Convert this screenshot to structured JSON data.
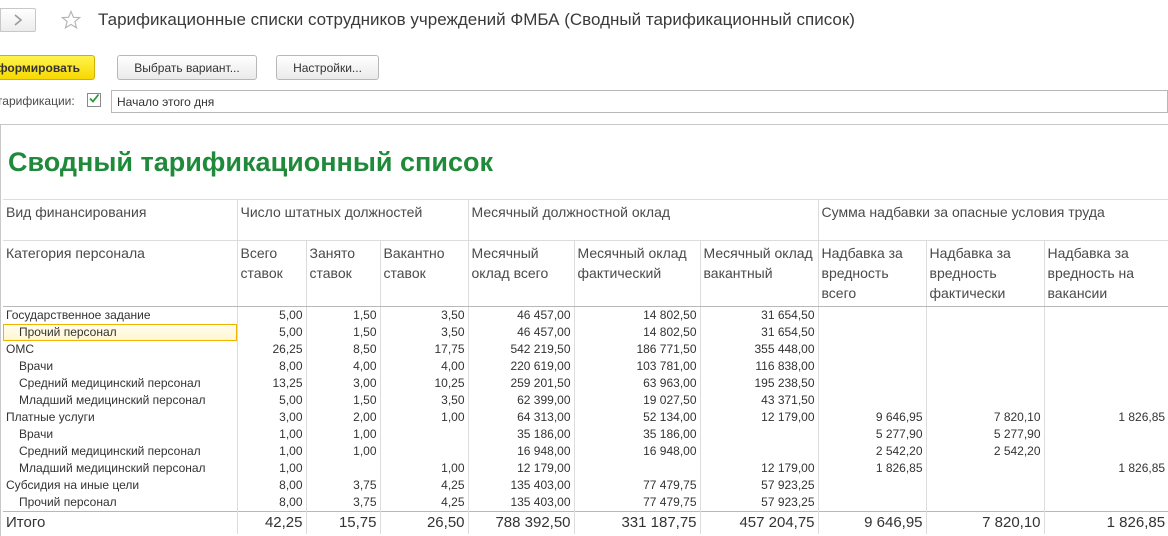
{
  "window": {
    "title": "Тарификационные списки сотрудников учреждений ФМБА (Сводный тарификационный список)"
  },
  "toolbar": {
    "generate_label": "Сформировать",
    "choose_variant_label": "Выбрать вариант...",
    "settings_label": "Настройки..."
  },
  "params": {
    "date_label": "Дата тарификации:",
    "date_checked": true,
    "date_value": "Начало этого дня"
  },
  "colors": {
    "title_green": "#1f8a3a",
    "primary_button": "#f7d800",
    "selection_outline": "#f0b400"
  },
  "report": {
    "title": "Сводный тарификационный список",
    "header_row1": {
      "funding": "Вид финансирования",
      "staff_positions": "Число штатных должностей",
      "monthly_salary": "Месячный должностной оклад",
      "hazard_bonus": "Сумма надбавки за опасные условия труда"
    },
    "header_row2": {
      "category": "Категория персонала",
      "c1": "Всего ставок",
      "c2": "Занято ставок",
      "c3": "Вакантно ставок",
      "c4": "Месячный оклад всего",
      "c5": "Месячный оклад фактический",
      "c6": "Месячный оклад вакантный",
      "c7": "Надбавка за вредность всего",
      "c8": "Надбавка за вредность фактически",
      "c9": "Надбавка за вредность на вакансии"
    },
    "rows": [
      {
        "name": "Государственное задание",
        "level": 1,
        "v": [
          "5,00",
          "1,50",
          "3,50",
          "46 457,00",
          "14 802,50",
          "31 654,50",
          "",
          "",
          ""
        ]
      },
      {
        "name": "Прочий персонал",
        "level": 2,
        "selected": true,
        "v": [
          "5,00",
          "1,50",
          "3,50",
          "46 457,00",
          "14 802,50",
          "31 654,50",
          "",
          "",
          ""
        ]
      },
      {
        "name": "ОМС",
        "level": 1,
        "v": [
          "26,25",
          "8,50",
          "17,75",
          "542 219,50",
          "186 771,50",
          "355 448,00",
          "",
          "",
          ""
        ]
      },
      {
        "name": "Врачи",
        "level": 2,
        "v": [
          "8,00",
          "4,00",
          "4,00",
          "220 619,00",
          "103 781,00",
          "116 838,00",
          "",
          "",
          ""
        ]
      },
      {
        "name": "Средний медицинский персонал",
        "level": 2,
        "v": [
          "13,25",
          "3,00",
          "10,25",
          "259 201,50",
          "63 963,00",
          "195 238,50",
          "",
          "",
          ""
        ]
      },
      {
        "name": "Младший медицинский персонал",
        "level": 2,
        "v": [
          "5,00",
          "1,50",
          "3,50",
          "62 399,00",
          "19 027,50",
          "43 371,50",
          "",
          "",
          ""
        ]
      },
      {
        "name": "Платные услуги",
        "level": 1,
        "v": [
          "3,00",
          "2,00",
          "1,00",
          "64 313,00",
          "52 134,00",
          "12 179,00",
          "9 646,95",
          "7 820,10",
          "1 826,85"
        ]
      },
      {
        "name": "Врачи",
        "level": 2,
        "v": [
          "1,00",
          "1,00",
          "",
          "35 186,00",
          "35 186,00",
          "",
          "5 277,90",
          "5 277,90",
          ""
        ]
      },
      {
        "name": "Средний медицинский персонал",
        "level": 2,
        "v": [
          "1,00",
          "1,00",
          "",
          "16 948,00",
          "16 948,00",
          "",
          "2 542,20",
          "2 542,20",
          ""
        ]
      },
      {
        "name": "Младший медицинский персонал",
        "level": 2,
        "v": [
          "1,00",
          "",
          "1,00",
          "12 179,00",
          "",
          "12 179,00",
          "1 826,85",
          "",
          "1 826,85"
        ]
      },
      {
        "name": "Субсидия на иные цели",
        "level": 1,
        "v": [
          "8,00",
          "3,75",
          "4,25",
          "135 403,00",
          "77 479,75",
          "57 923,25",
          "",
          "",
          ""
        ]
      },
      {
        "name": "Прочий персонал",
        "level": 2,
        "v": [
          "8,00",
          "3,75",
          "4,25",
          "135 403,00",
          "77 479,75",
          "57 923,25",
          "",
          "",
          ""
        ]
      }
    ],
    "total": {
      "label": "Итого",
      "v": [
        "42,25",
        "15,75",
        "26,50",
        "788 392,50",
        "331 187,75",
        "457 204,75",
        "9 646,95",
        "7 820,10",
        "1 826,85"
      ]
    }
  }
}
